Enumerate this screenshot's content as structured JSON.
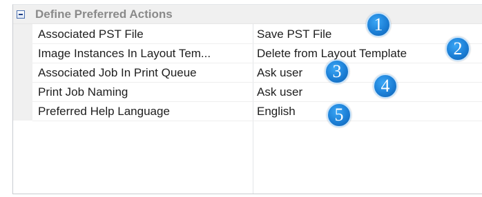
{
  "category": {
    "label": "Define Preferred Actions",
    "expanded": true,
    "toggle_icon": "minus-collapse-icon"
  },
  "properties": [
    {
      "name": "Associated PST File",
      "value": "Save PST File"
    },
    {
      "name": "Image Instances In Layout Tem...",
      "value": "Delete from Layout Template"
    },
    {
      "name": "Associated Job In Print Queue",
      "value": "Ask user"
    },
    {
      "name": "Print Job Naming",
      "value": "Ask user"
    },
    {
      "name": "Preferred Help Language",
      "value": "English"
    }
  ],
  "callouts": [
    {
      "number": "1"
    },
    {
      "number": "2"
    },
    {
      "number": "3"
    },
    {
      "number": "4"
    },
    {
      "number": "5"
    }
  ],
  "colors": {
    "category_text": "#8a8a8a",
    "row_text": "#1e1e1e",
    "gutter": "#f0f0f0",
    "callout_fill": "#1c7fd6",
    "toggle_border": "#4a6fb0"
  }
}
